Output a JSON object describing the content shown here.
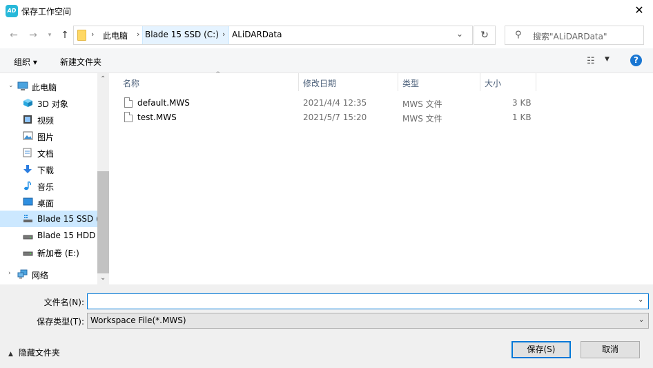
{
  "window": {
    "app_icon_text": "AD",
    "title": "保存工作空间"
  },
  "nav": {
    "breadcrumbs": [
      "此电脑",
      "Blade 15 SSD (C:)",
      "ALiDARData"
    ],
    "search_placeholder": "搜索\"ALiDARData\""
  },
  "toolbar": {
    "organize": "组织 ▾",
    "new_folder": "新建文件夹"
  },
  "sidebar": {
    "items": [
      {
        "label": "此电脑",
        "icon": "computer-icon"
      },
      {
        "label": "3D 对象",
        "icon": "cube-icon"
      },
      {
        "label": "视频",
        "icon": "video-icon"
      },
      {
        "label": "图片",
        "icon": "picture-icon"
      },
      {
        "label": "文档",
        "icon": "document-icon"
      },
      {
        "label": "下载",
        "icon": "download-icon"
      },
      {
        "label": "音乐",
        "icon": "music-icon"
      },
      {
        "label": "桌面",
        "icon": "desktop-icon"
      },
      {
        "label": "Blade 15 SSD (",
        "icon": "drive-icon",
        "selected": true
      },
      {
        "label": "Blade 15 HDD",
        "icon": "drive-icon"
      },
      {
        "label": "新加卷 (E:)",
        "icon": "drive-icon"
      },
      {
        "label": "网络",
        "icon": "network-icon"
      }
    ]
  },
  "files": {
    "columns": [
      "名称",
      "修改日期",
      "类型",
      "大小"
    ],
    "rows": [
      {
        "name": "default.MWS",
        "date": "2021/4/4 12:35",
        "type": "MWS 文件",
        "size": "3 KB"
      },
      {
        "name": "test.MWS",
        "date": "2021/5/7 15:20",
        "type": "MWS 文件",
        "size": "1 KB"
      }
    ]
  },
  "form": {
    "filename_label": "文件名(N):",
    "filename_value": "",
    "filetype_label": "保存类型(T):",
    "filetype_value": "Workspace File(*.MWS)",
    "hide_folders": "隐藏文件夹",
    "save_button": "保存(S)",
    "cancel_button": "取消"
  },
  "colors": {
    "accent": "#0078d7",
    "selection": "#cce8ff"
  }
}
